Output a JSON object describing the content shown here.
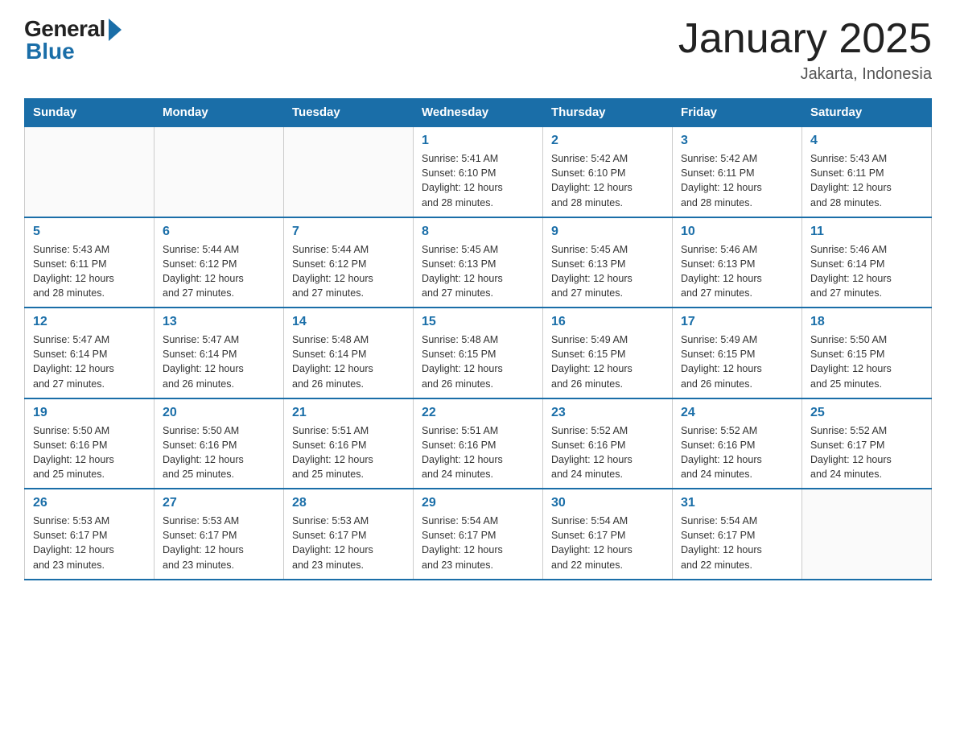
{
  "logo": {
    "general": "General",
    "blue": "Blue"
  },
  "title": {
    "month_year": "January 2025",
    "location": "Jakarta, Indonesia"
  },
  "weekdays": [
    "Sunday",
    "Monday",
    "Tuesday",
    "Wednesday",
    "Thursday",
    "Friday",
    "Saturday"
  ],
  "weeks": [
    [
      {
        "day": "",
        "info": ""
      },
      {
        "day": "",
        "info": ""
      },
      {
        "day": "",
        "info": ""
      },
      {
        "day": "1",
        "info": "Sunrise: 5:41 AM\nSunset: 6:10 PM\nDaylight: 12 hours\nand 28 minutes."
      },
      {
        "day": "2",
        "info": "Sunrise: 5:42 AM\nSunset: 6:10 PM\nDaylight: 12 hours\nand 28 minutes."
      },
      {
        "day": "3",
        "info": "Sunrise: 5:42 AM\nSunset: 6:11 PM\nDaylight: 12 hours\nand 28 minutes."
      },
      {
        "day": "4",
        "info": "Sunrise: 5:43 AM\nSunset: 6:11 PM\nDaylight: 12 hours\nand 28 minutes."
      }
    ],
    [
      {
        "day": "5",
        "info": "Sunrise: 5:43 AM\nSunset: 6:11 PM\nDaylight: 12 hours\nand 28 minutes."
      },
      {
        "day": "6",
        "info": "Sunrise: 5:44 AM\nSunset: 6:12 PM\nDaylight: 12 hours\nand 27 minutes."
      },
      {
        "day": "7",
        "info": "Sunrise: 5:44 AM\nSunset: 6:12 PM\nDaylight: 12 hours\nand 27 minutes."
      },
      {
        "day": "8",
        "info": "Sunrise: 5:45 AM\nSunset: 6:13 PM\nDaylight: 12 hours\nand 27 minutes."
      },
      {
        "day": "9",
        "info": "Sunrise: 5:45 AM\nSunset: 6:13 PM\nDaylight: 12 hours\nand 27 minutes."
      },
      {
        "day": "10",
        "info": "Sunrise: 5:46 AM\nSunset: 6:13 PM\nDaylight: 12 hours\nand 27 minutes."
      },
      {
        "day": "11",
        "info": "Sunrise: 5:46 AM\nSunset: 6:14 PM\nDaylight: 12 hours\nand 27 minutes."
      }
    ],
    [
      {
        "day": "12",
        "info": "Sunrise: 5:47 AM\nSunset: 6:14 PM\nDaylight: 12 hours\nand 27 minutes."
      },
      {
        "day": "13",
        "info": "Sunrise: 5:47 AM\nSunset: 6:14 PM\nDaylight: 12 hours\nand 26 minutes."
      },
      {
        "day": "14",
        "info": "Sunrise: 5:48 AM\nSunset: 6:14 PM\nDaylight: 12 hours\nand 26 minutes."
      },
      {
        "day": "15",
        "info": "Sunrise: 5:48 AM\nSunset: 6:15 PM\nDaylight: 12 hours\nand 26 minutes."
      },
      {
        "day": "16",
        "info": "Sunrise: 5:49 AM\nSunset: 6:15 PM\nDaylight: 12 hours\nand 26 minutes."
      },
      {
        "day": "17",
        "info": "Sunrise: 5:49 AM\nSunset: 6:15 PM\nDaylight: 12 hours\nand 26 minutes."
      },
      {
        "day": "18",
        "info": "Sunrise: 5:50 AM\nSunset: 6:15 PM\nDaylight: 12 hours\nand 25 minutes."
      }
    ],
    [
      {
        "day": "19",
        "info": "Sunrise: 5:50 AM\nSunset: 6:16 PM\nDaylight: 12 hours\nand 25 minutes."
      },
      {
        "day": "20",
        "info": "Sunrise: 5:50 AM\nSunset: 6:16 PM\nDaylight: 12 hours\nand 25 minutes."
      },
      {
        "day": "21",
        "info": "Sunrise: 5:51 AM\nSunset: 6:16 PM\nDaylight: 12 hours\nand 25 minutes."
      },
      {
        "day": "22",
        "info": "Sunrise: 5:51 AM\nSunset: 6:16 PM\nDaylight: 12 hours\nand 24 minutes."
      },
      {
        "day": "23",
        "info": "Sunrise: 5:52 AM\nSunset: 6:16 PM\nDaylight: 12 hours\nand 24 minutes."
      },
      {
        "day": "24",
        "info": "Sunrise: 5:52 AM\nSunset: 6:16 PM\nDaylight: 12 hours\nand 24 minutes."
      },
      {
        "day": "25",
        "info": "Sunrise: 5:52 AM\nSunset: 6:17 PM\nDaylight: 12 hours\nand 24 minutes."
      }
    ],
    [
      {
        "day": "26",
        "info": "Sunrise: 5:53 AM\nSunset: 6:17 PM\nDaylight: 12 hours\nand 23 minutes."
      },
      {
        "day": "27",
        "info": "Sunrise: 5:53 AM\nSunset: 6:17 PM\nDaylight: 12 hours\nand 23 minutes."
      },
      {
        "day": "28",
        "info": "Sunrise: 5:53 AM\nSunset: 6:17 PM\nDaylight: 12 hours\nand 23 minutes."
      },
      {
        "day": "29",
        "info": "Sunrise: 5:54 AM\nSunset: 6:17 PM\nDaylight: 12 hours\nand 23 minutes."
      },
      {
        "day": "30",
        "info": "Sunrise: 5:54 AM\nSunset: 6:17 PM\nDaylight: 12 hours\nand 22 minutes."
      },
      {
        "day": "31",
        "info": "Sunrise: 5:54 AM\nSunset: 6:17 PM\nDaylight: 12 hours\nand 22 minutes."
      },
      {
        "day": "",
        "info": ""
      }
    ]
  ]
}
